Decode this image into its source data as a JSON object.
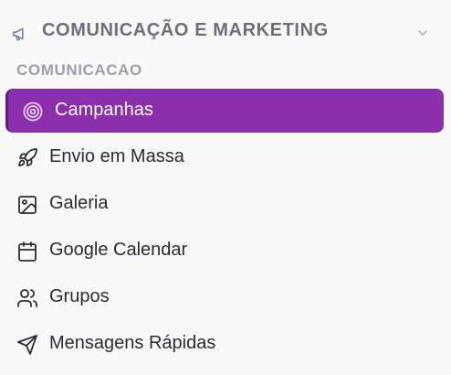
{
  "section": {
    "title": "COMUNICAÇÃO E MARKETING",
    "icon": "megaphone-icon",
    "expanded": true
  },
  "group": {
    "label": "COMUNICACAO"
  },
  "colors": {
    "active_bg": "#8b2fad",
    "active_border": "#5e1d77",
    "text": "#2b2c33",
    "section_title": "#6e6f78",
    "group_label": "#9d9ea6"
  },
  "menu": {
    "items": [
      {
        "label": "Campanhas",
        "icon": "target-icon",
        "active": true
      },
      {
        "label": "Envio em Massa",
        "icon": "rocket-icon",
        "active": false
      },
      {
        "label": "Galeria",
        "icon": "image-icon",
        "active": false
      },
      {
        "label": "Google Calendar",
        "icon": "calendar-icon",
        "active": false
      },
      {
        "label": "Grupos",
        "icon": "users-icon",
        "active": false
      },
      {
        "label": "Mensagens Rápidas",
        "icon": "send-icon",
        "active": false
      }
    ]
  }
}
